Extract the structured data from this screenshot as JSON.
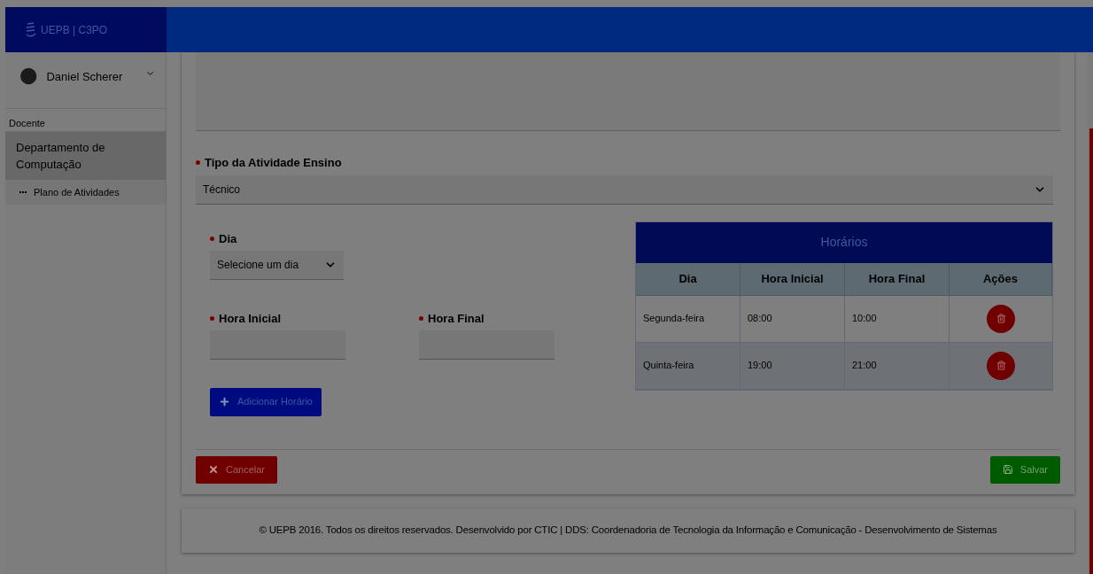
{
  "header": {
    "logo_text": "UEPB | C3PO"
  },
  "user": {
    "name": "Daniel Scherer"
  },
  "sidebar": {
    "section": "Docente",
    "items": [
      {
        "label": "Departamento de Computação",
        "selected": true,
        "children": [
          {
            "label": "Plano de Atividades",
            "selected": false
          }
        ]
      }
    ]
  },
  "form": {
    "tipo": {
      "label": "Tipo da Atividade Ensino",
      "value": "Técnico"
    },
    "dia": {
      "label": "Dia",
      "value": "Selecione um dia"
    },
    "hora_inicial": {
      "label": "Hora Inicial"
    },
    "hora_final": {
      "label": "Hora Final"
    },
    "add_button": "Adicionar Horário"
  },
  "table": {
    "title": "Horários",
    "columns": [
      "Dia",
      "Hora Inicial",
      "Hora Final",
      "Ações"
    ],
    "rows": [
      {
        "dia": "Segunda-feira",
        "inicio": "08:00",
        "fim": "10:00"
      },
      {
        "dia": "Quinta-feira",
        "inicio": "19:00",
        "fim": "21:00"
      }
    ]
  },
  "buttons": {
    "cancel": "Cancelar",
    "save": "Salvar"
  },
  "footer": "© UEPB 2016. Todos os direitos reservados. Desenvolvido por CTIC | DDS: Coordenadoria de Tecnologia da Informação e Comunicação - Desenvolvimento de Sistemas"
}
